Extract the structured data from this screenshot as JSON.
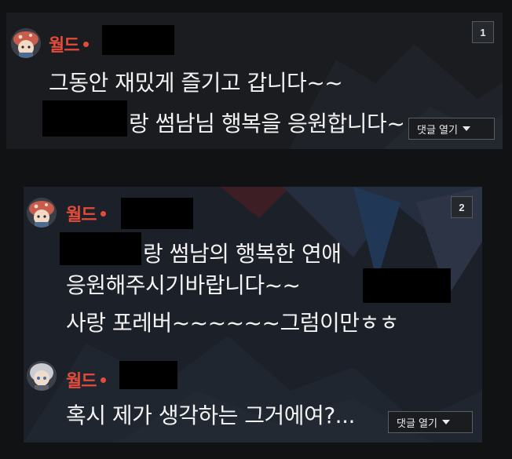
{
  "comments": [
    {
      "rank": "1",
      "author": "월드",
      "lines": [
        "그동안 재밌게 즐기고 갑니다~~",
        "랑 썸남님 행복을 응원합니다~"
      ],
      "reply_button": "댓글 열기"
    },
    {
      "rank": "2",
      "author": "월드",
      "lines": [
        "랑 썸남의 행복한 연애",
        "응원해주시기바랍니다~~",
        "사랑 포레버~~~~~~그럼이만ㅎㅎ"
      ],
      "reply": {
        "author": "월드",
        "line": "혹시 제가 생각하는 그거에여?..."
      },
      "reply_button": "댓글 열기"
    }
  ],
  "icons": {
    "avatar_1": "mushroom-avatar",
    "avatar_2": "mushroom-avatar",
    "avatar_3": "silver-avatar",
    "reply_caret": "caret-down-icon"
  },
  "colors": {
    "author_name": "#e44b3a",
    "card_bg": "#1b1d21",
    "page_bg": "#111213"
  }
}
